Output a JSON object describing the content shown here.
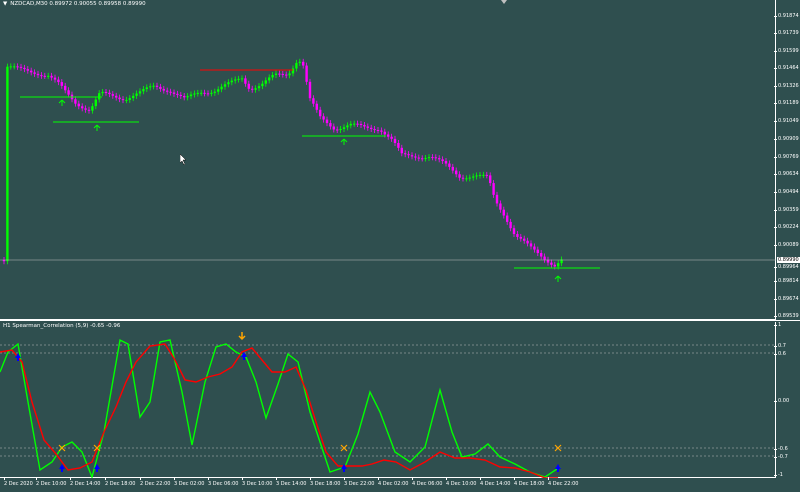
{
  "main_chart": {
    "title": "NZDCAD,M30  0.89972 0.90055 0.89958 0.89990",
    "price_labels": [
      "0.91874",
      "0.91739",
      "0.91599",
      "0.91464",
      "0.91326",
      "0.91189",
      "0.91049",
      "0.90909",
      "0.90769",
      "0.90634",
      "0.90494",
      "0.90359",
      "0.90224",
      "0.90089",
      "0.89964",
      "0.89814",
      "0.89674",
      "0.89539"
    ],
    "current_price": "0.89990",
    "colors": {
      "background": "#2f4f4f",
      "bull_candle": "#00ff00",
      "bear_candle": "#ff00ff",
      "level_line": "#00ff00",
      "resistance_line": "#ff0000",
      "current_price_line": "#c0c0c0"
    }
  },
  "indicator": {
    "title": "H1  Spearman_Correlation (5,9) -0.65 -0.96",
    "levels": [
      "1",
      "0.7",
      "0.6",
      "0.00",
      "-0.6",
      "-0.7",
      "-1"
    ],
    "colors": {
      "fast_line": "#00ff00",
      "slow_line": "#ff0000",
      "level_line": "#c0c0c0",
      "buy_arrow": "#0000ff",
      "sell_marker": "#ffa500"
    }
  },
  "time_axis": {
    "labels": [
      "2 Dec 2020",
      "2 Dec 10:00",
      "2 Dec 14:00",
      "2 Dec 18:00",
      "2 Dec 22:00",
      "3 Dec 02:00",
      "3 Dec 06:00",
      "3 Dec 10:00",
      "3 Dec 14:00",
      "3 Dec 18:00",
      "3 Dec 22:00",
      "4 Dec 02:00",
      "4 Dec 06:00",
      "4 Dec 10:00",
      "4 Dec 14:00",
      "4 Dec 18:00",
      "4 Dec 22:00"
    ]
  }
}
